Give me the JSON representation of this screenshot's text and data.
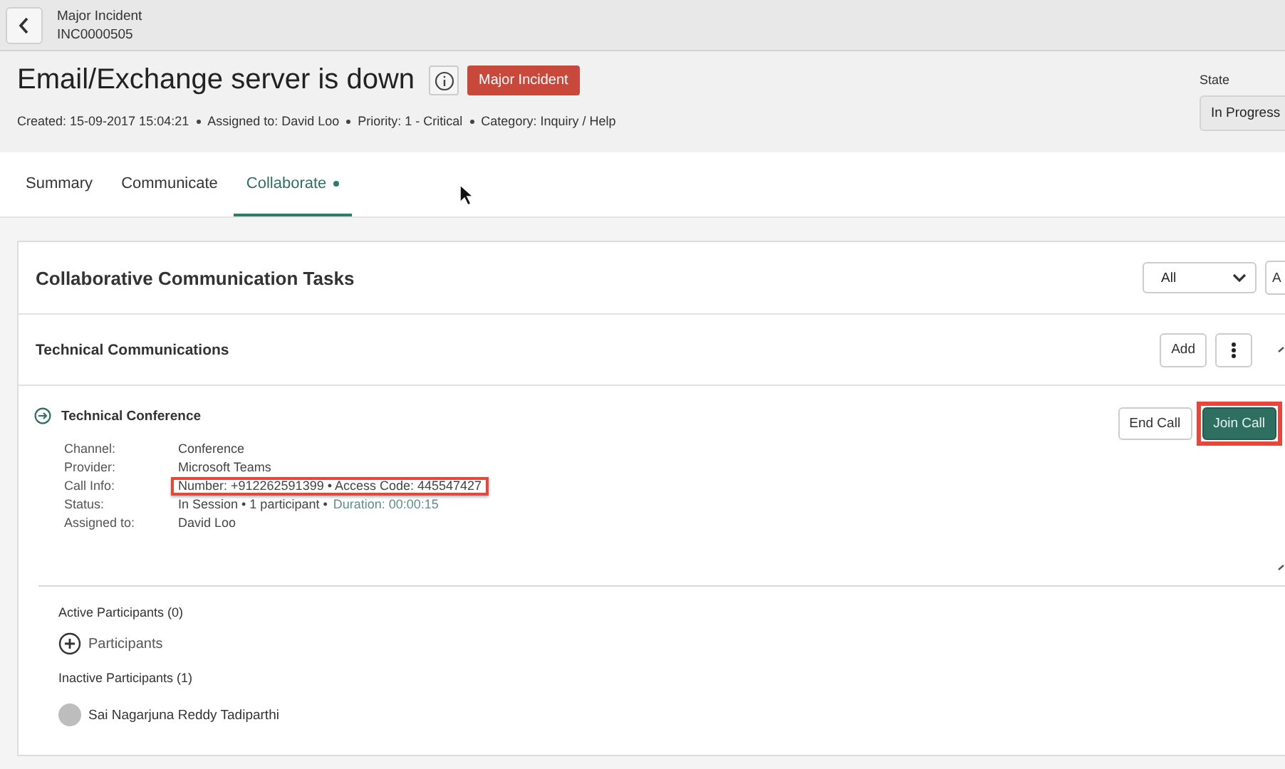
{
  "topbar": {
    "title": "Major Incident",
    "number": "INC0000505"
  },
  "record": {
    "title": "Email/Exchange server is down",
    "badge": "Major Incident",
    "meta": [
      "Created: 15-09-2017 15:04:21",
      "Assigned to: David Loo",
      "Priority: 1 - Critical",
      "Category: Inquiry / Help"
    ],
    "state": {
      "label": "State",
      "value": "In Progress"
    }
  },
  "tabs": [
    {
      "label": "Summary",
      "selected": false,
      "indicator": false
    },
    {
      "label": "Communicate",
      "selected": false,
      "indicator": false
    },
    {
      "label": "Collaborate",
      "selected": true,
      "indicator": true
    }
  ],
  "panel": {
    "title": "Collaborative Communication Tasks",
    "filter": "All",
    "cut_button": "A",
    "section": {
      "title": "Technical Communications",
      "buttons": [
        "Add"
      ]
    },
    "task": {
      "title": "Technical Conference",
      "actions": [
        {
          "label": "End Call",
          "kind": "secondary",
          "highlighted": false
        },
        {
          "label": "Join Call",
          "kind": "primary",
          "highlighted": true
        }
      ],
      "fields": [
        {
          "label": "Channel:",
          "value": "Conference",
          "highlighted": false
        },
        {
          "label": "Provider:",
          "value": "Microsoft Teams",
          "highlighted": false
        },
        {
          "label": "Call Info:",
          "value": "Number: +912262591399  • Access Code: 445547427",
          "highlighted": true
        },
        {
          "label": "Status:",
          "value": "In Session • 1 participant •",
          "extra": "Duration: 00:00:15",
          "highlighted": false
        },
        {
          "label": "Assigned to:",
          "value": "David Loo",
          "highlighted": false
        }
      ]
    },
    "active": {
      "title": "Active Participants (0)",
      "add_label": "Participants"
    },
    "inactive": {
      "title": "Inactive Participants (1)",
      "people": [
        {
          "name": "Sai Nagarjuna Reddy Tadiparthi"
        }
      ]
    }
  }
}
